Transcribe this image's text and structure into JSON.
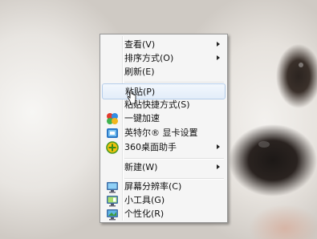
{
  "context_menu": {
    "items": [
      {
        "label": "查看(V)",
        "has_submenu": true
      },
      {
        "label": "排序方式(O)",
        "has_submenu": true
      },
      {
        "label": "刷新(E)",
        "has_submenu": false
      },
      {
        "label": "粘贴(P)",
        "has_submenu": false,
        "highlighted": true
      },
      {
        "label": "粘贴快捷方式(S)",
        "has_submenu": false
      },
      {
        "label": "一键加速",
        "icon": "360-speedup-icon",
        "has_submenu": false
      },
      {
        "label": "英特尔® 显卡设置",
        "icon": "intel-graphics-icon",
        "has_submenu": false
      },
      {
        "label": "360桌面助手",
        "icon": "360-desktop-helper-icon",
        "has_submenu": true
      },
      {
        "label": "新建(W)",
        "has_submenu": true
      },
      {
        "label": "屏幕分辨率(C)",
        "icon": "monitor-icon",
        "has_submenu": false
      },
      {
        "label": "小工具(G)",
        "icon": "gadgets-icon",
        "has_submenu": false
      },
      {
        "label": "个性化(R)",
        "icon": "personalize-icon",
        "has_submenu": false
      }
    ]
  },
  "colors": {
    "menu_background": "#f5f5f5",
    "highlight_border": "#b5cdea",
    "highlight_fill": "#e3edf9"
  }
}
